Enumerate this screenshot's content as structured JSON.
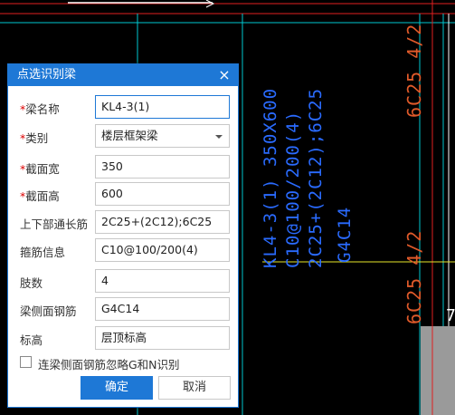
{
  "cad": {
    "beam_text": [
      "KL4-3(1) 350X600",
      "C10@100/200(4)",
      "2C25+(2C12);6C25",
      "G4C14"
    ],
    "orange_top": "6C25 4/2",
    "orange_bottom": "6C25 4/2",
    "edge_glyph": "7"
  },
  "dialog": {
    "title": "点选识别梁",
    "close_glyph": "×",
    "fields": [
      {
        "required": "*",
        "label": "梁名称",
        "value": "KL4-3(1)"
      },
      {
        "required": "*",
        "label": "类别",
        "value": "楼层框架梁"
      },
      {
        "required": "*",
        "label": "截面宽",
        "value": "350"
      },
      {
        "required": "*",
        "label": "截面高",
        "value": "600"
      },
      {
        "required": "",
        "label": "上下部通长筋",
        "value": "2C25+(2C12);6C25"
      },
      {
        "required": "",
        "label": "箍筋信息",
        "value": "C10@100/200(4)"
      },
      {
        "required": "",
        "label": "肢数",
        "value": "4"
      },
      {
        "required": "",
        "label": "梁侧面钢筋",
        "value": "G4C14"
      },
      {
        "required": "",
        "label": "标高",
        "value": "层顶标高"
      }
    ],
    "checkbox_label": "连梁侧面钢筋忽略G和N识别",
    "ok_label": "确定",
    "cancel_label": "取消"
  },
  "colors": {
    "accent": "#1e78d6",
    "cad_cyan": "#00c8d0",
    "cad_red": "#e02020",
    "cad_yellow": "#e6e62a",
    "cad_orange": "#e05a2a"
  }
}
